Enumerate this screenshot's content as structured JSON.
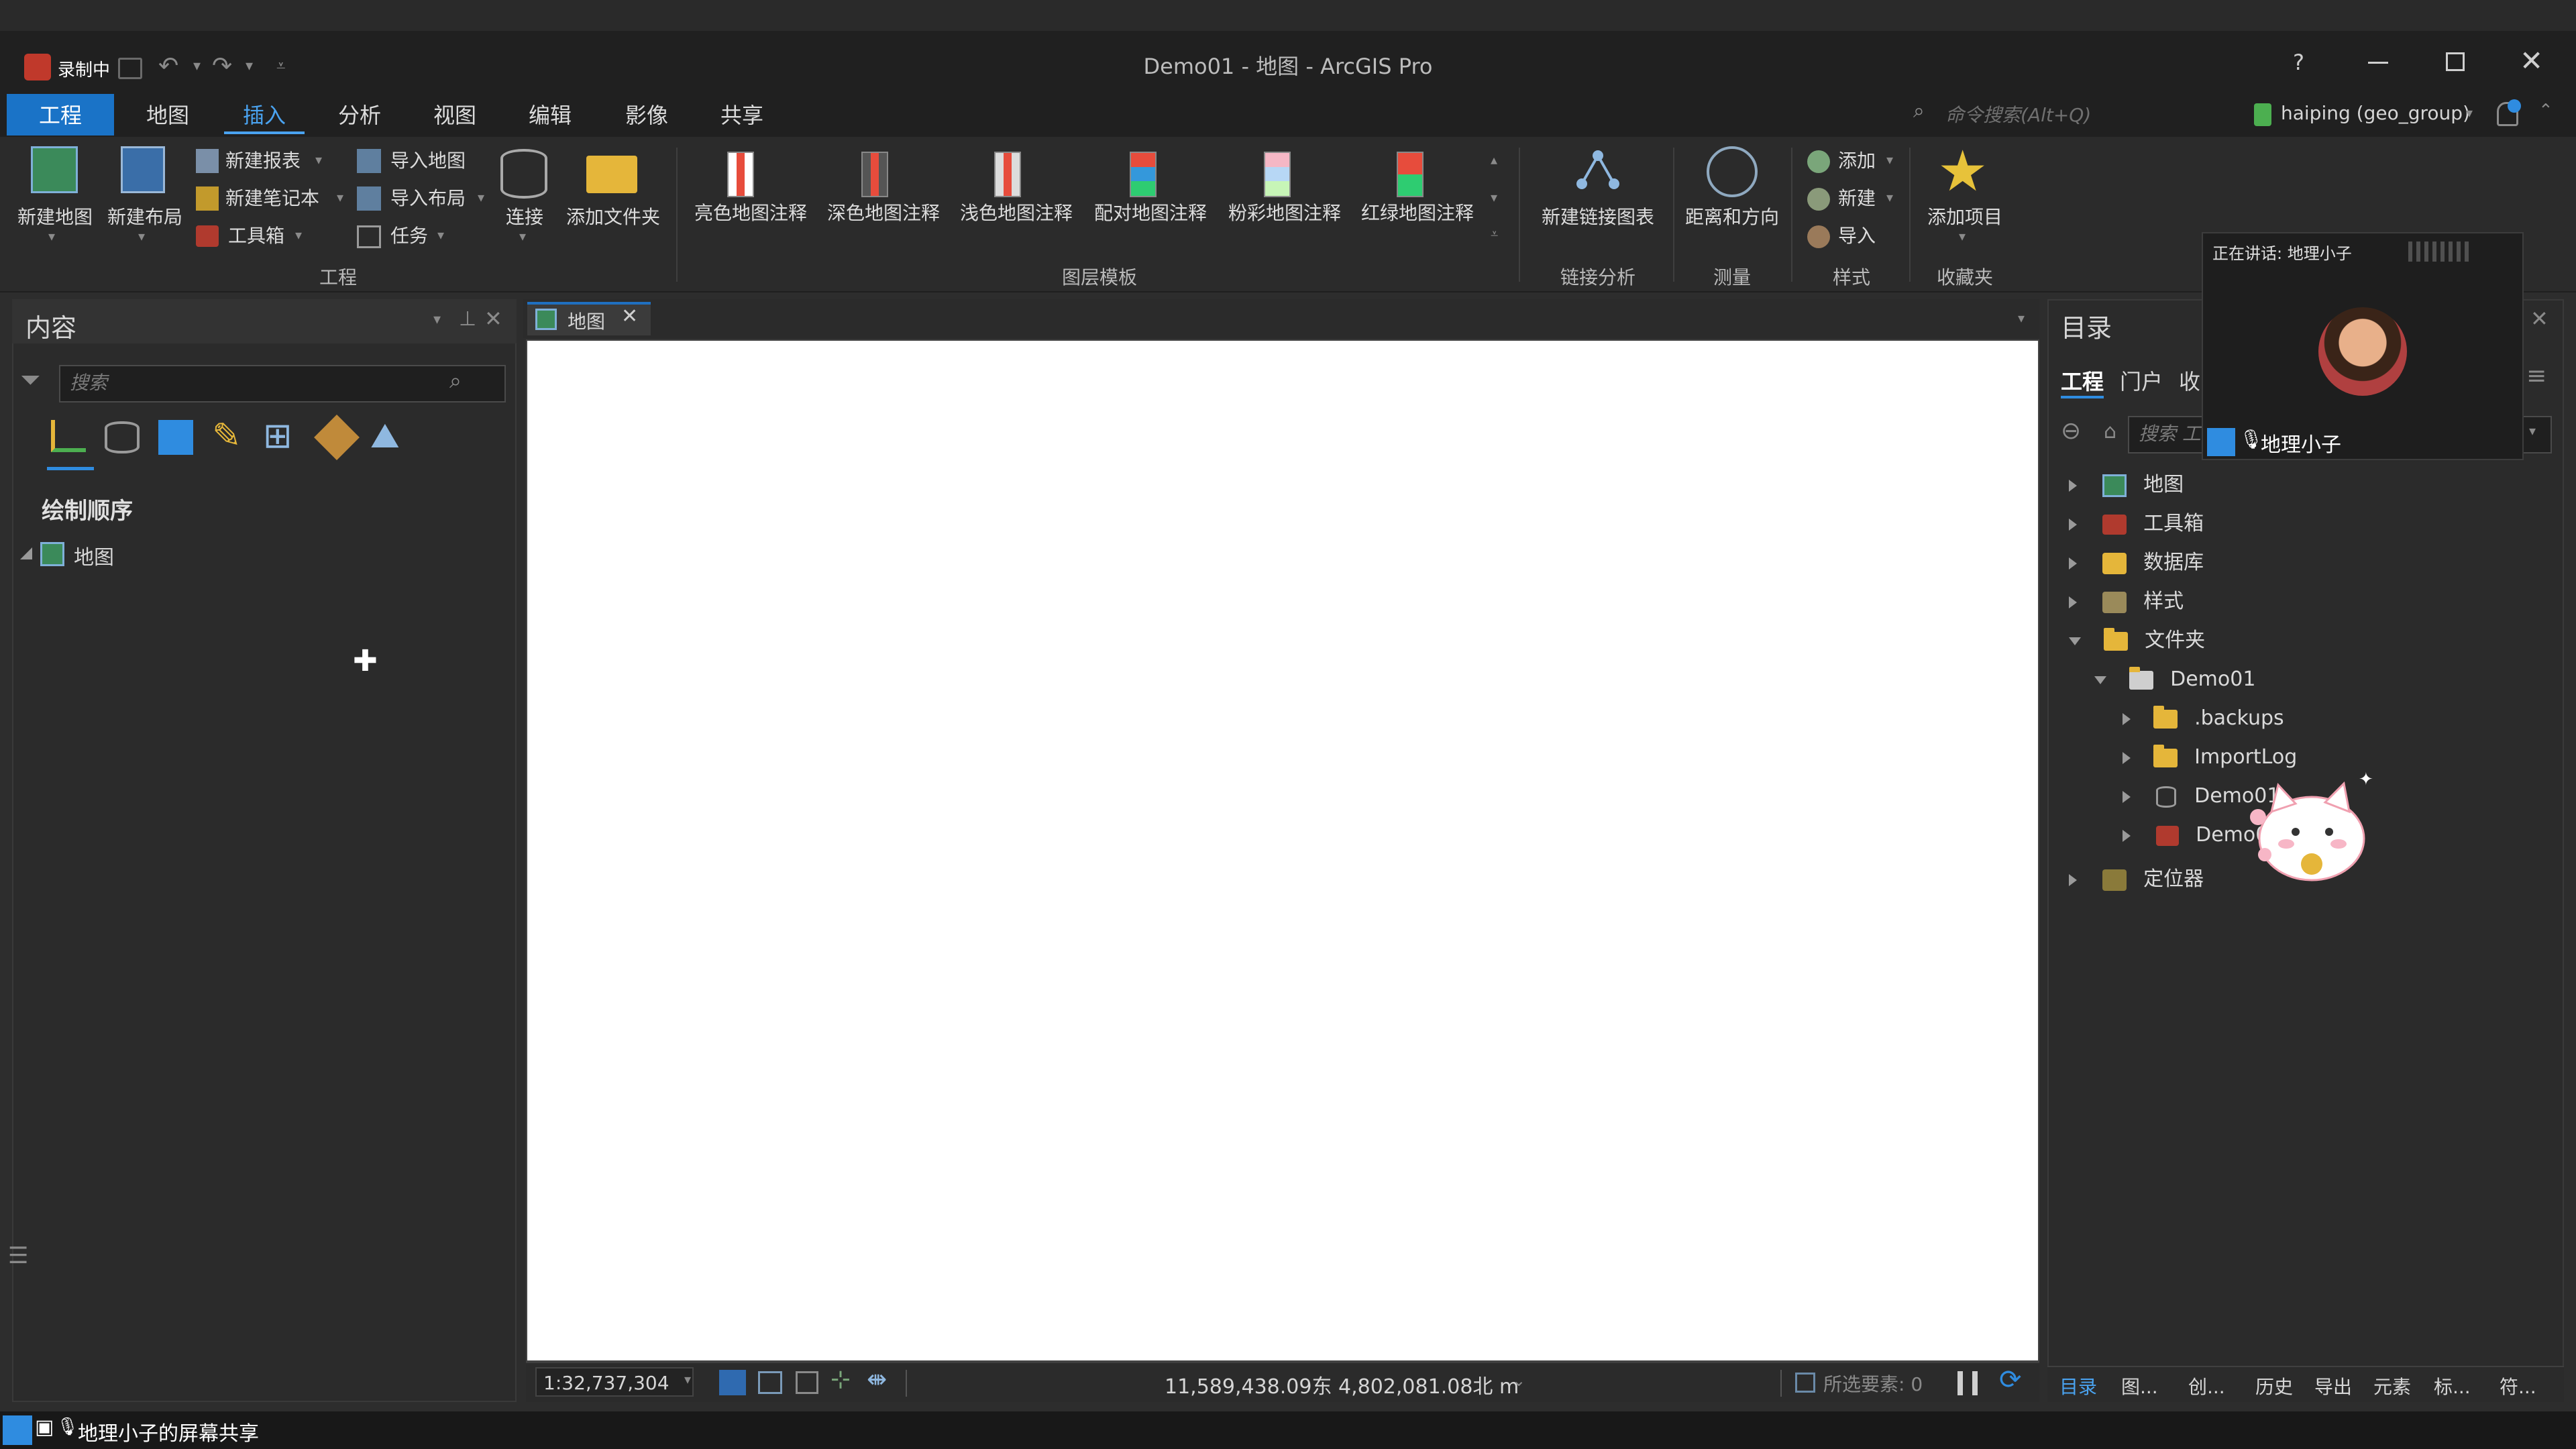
{
  "window": {
    "title": "Demo01 - 地图 - ArcGIS Pro",
    "recording_label": "录制中",
    "help": "?",
    "command_search_placeholder": "命令搜索(Alt+Q)",
    "user": "haiping (geo_group)"
  },
  "menu": {
    "tabs": [
      "工程",
      "地图",
      "插入",
      "分析",
      "视图",
      "编辑",
      "影像",
      "共享"
    ],
    "active": "插入"
  },
  "ribbon": {
    "project_group": {
      "label": "工程",
      "new_map": "新建地图",
      "new_layout": "新建布局",
      "new_report": "新建报表",
      "new_notebook": "新建笔记本",
      "toolbox": "工具箱",
      "import_map": "导入地图",
      "import_layout": "导入布局",
      "task": "任务",
      "connect": "连接",
      "add_folder": "添加文件夹"
    },
    "layer_templates_group": {
      "label": "图层模板",
      "items": [
        "亮色地图注释",
        "深色地图注释",
        "浅色地图注释",
        "配对地图注释",
        "粉彩地图注释",
        "红绿地图注释"
      ]
    },
    "link_analysis_group": {
      "label": "链接分析",
      "new_link_chart": "新建链接图表"
    },
    "measure_group": {
      "label": "测量",
      "distance_direction": "距离和方向"
    },
    "styles_group": {
      "label": "样式",
      "add": "添加",
      "new": "新建",
      "import": "导入"
    },
    "favorites_group": {
      "label": "收藏夹",
      "add_item": "添加项目"
    }
  },
  "contents": {
    "title": "内容",
    "search_placeholder": "搜索",
    "drawing_order": "绘制顺序",
    "layer": "地图"
  },
  "map_tab": {
    "label": "地图"
  },
  "status": {
    "scale": "1:32,737,304",
    "coordinates": "11,589,438.09东 4,802,081.08北 m",
    "selected_features": "所选要素: 0"
  },
  "catalog": {
    "title": "目录",
    "tabs": [
      "工程",
      "门户",
      "收"
    ],
    "search_placeholder": "搜索 工",
    "tree": {
      "maps": "地图",
      "toolboxes": "工具箱",
      "databases": "数据库",
      "styles": "样式",
      "folders": "文件夹",
      "demo01": "Demo01",
      "backups": ".backups",
      "importlog": "ImportLog",
      "demo01_gdb": "Demo01",
      "demo01_tbx": "Demo01",
      "locators": "定位器"
    },
    "bottom_tabs": [
      "目录",
      "图...",
      "创...",
      "历史",
      "导出",
      "元素",
      "标...",
      "符..."
    ]
  },
  "speaker": {
    "talking": "正在讲话: 地理小子",
    "name": "地理小子"
  },
  "screen_share": {
    "label": "地理小子的屏幕共享"
  }
}
